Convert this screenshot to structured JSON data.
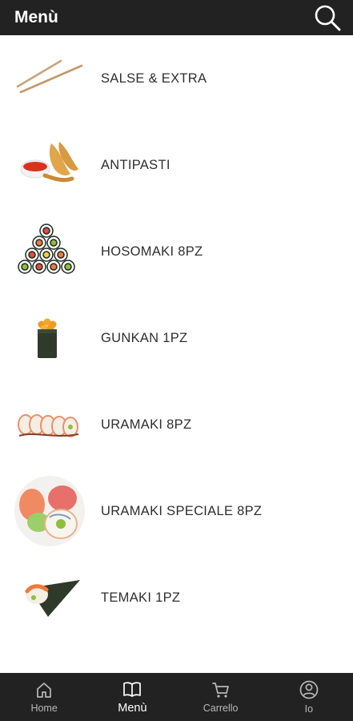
{
  "header": {
    "title": "Menù",
    "search_icon": "search-icon"
  },
  "menu": {
    "items": [
      {
        "label": "SALSE & EXTRA",
        "icon": "chopsticks-image"
      },
      {
        "label": "ANTIPASTI",
        "icon": "fried-shrimp-image"
      },
      {
        "label": "HOSOMAKI 8PZ",
        "icon": "hosomaki-pyramid-image"
      },
      {
        "label": "GUNKAN 1PZ",
        "icon": "gunkan-image"
      },
      {
        "label": "URAMAKI 8PZ",
        "icon": "uramaki-row-image"
      },
      {
        "label": "URAMAKI SPECIALE 8PZ",
        "icon": "uramaki-special-image"
      },
      {
        "label": "TEMAKI 1PZ",
        "icon": "temaki-cone-image"
      }
    ]
  },
  "bottom_nav": {
    "tabs": [
      {
        "label": "Home",
        "icon": "home-icon",
        "active": false
      },
      {
        "label": "Menù",
        "icon": "book-icon",
        "active": true
      },
      {
        "label": "Carrello",
        "icon": "cart-icon",
        "active": false
      },
      {
        "label": "Io",
        "icon": "user-icon",
        "active": false
      }
    ]
  },
  "colors": {
    "bar_background": "#222222",
    "active_tab": "#ffffff",
    "inactive_tab": "#b8b8b8"
  }
}
